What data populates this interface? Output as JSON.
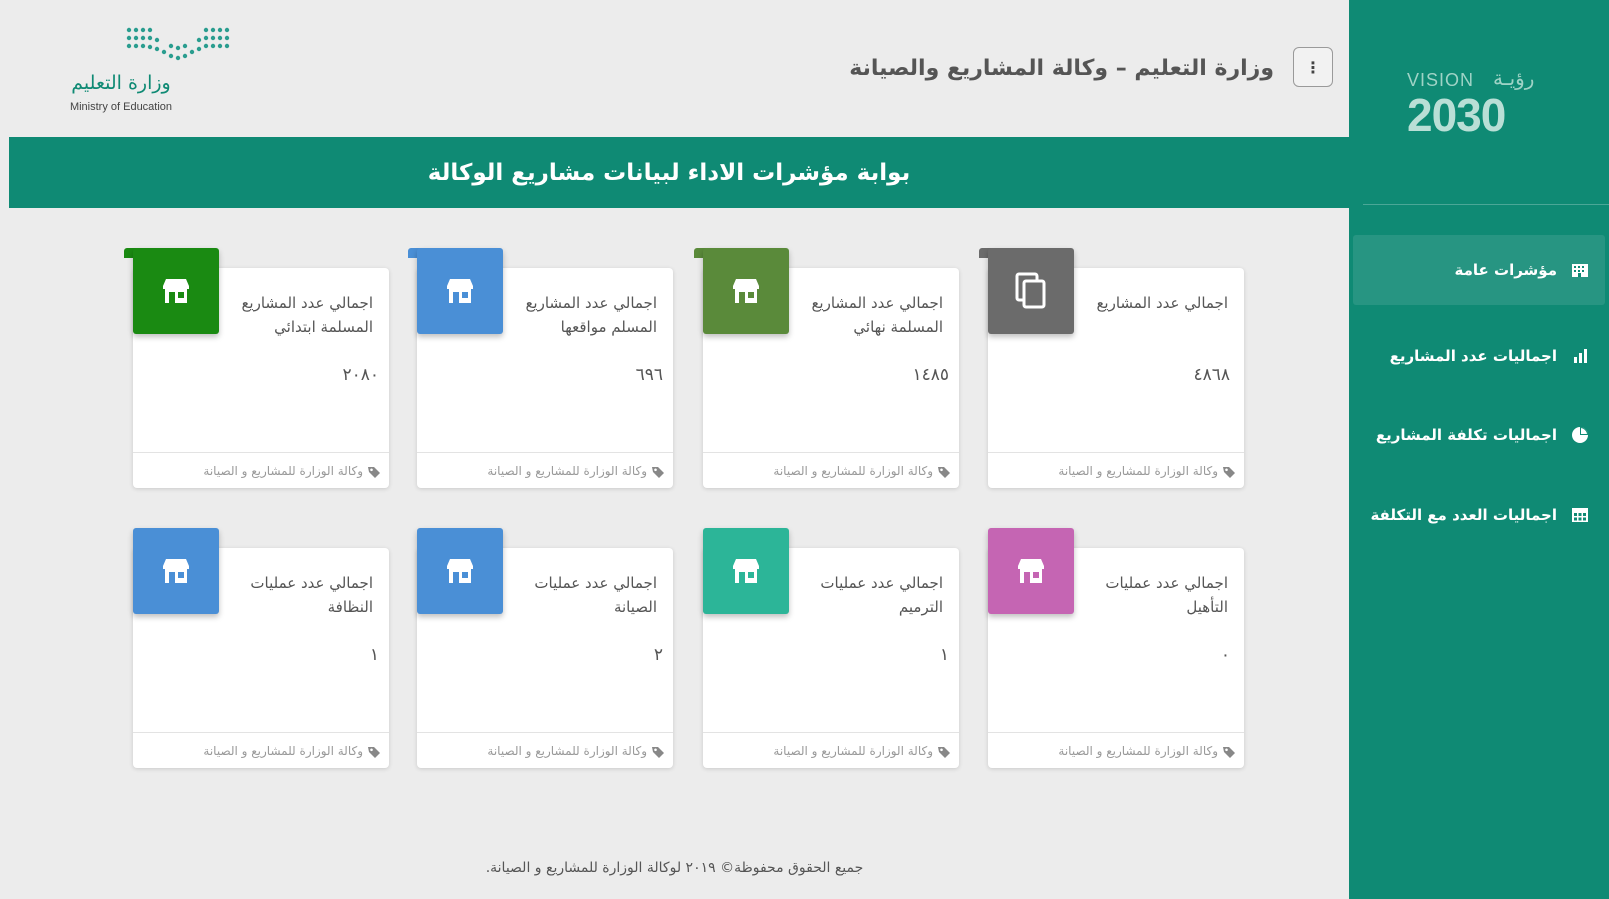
{
  "header": {
    "title": "وزارة التعليم – وكالة المشاريع والصيانة",
    "logo_arabic": "وزارة التعليم",
    "logo_english": "Ministry of Education",
    "menu_icon": "vertical-dots-icon",
    "menu_label": "⋮"
  },
  "banner": {
    "title": "بوابة مؤشرات الاداء لبيانات مشاريع الوكالة"
  },
  "sidebar": {
    "vision_word": "VISION",
    "vision_arabic": "رؤيـة",
    "vision_year": "2030",
    "items": [
      {
        "label": "مؤشرات عامة",
        "icon": "building-icon",
        "active": true
      },
      {
        "label": "اجماليات عدد المشاريع",
        "icon": "bar-chart-icon",
        "active": false
      },
      {
        "label": "اجماليات تكلفة المشاريع",
        "icon": "pie-chart-icon",
        "active": false
      },
      {
        "label": "اجماليات العدد مع التكلفة",
        "icon": "table-icon",
        "active": false
      }
    ]
  },
  "cards": [
    {
      "label": "اجمالي عدد المشاريع",
      "value": "٤٨٦٨",
      "color": "#6b6b6b",
      "icon": "copy-icon",
      "footer": "وكالة الوزارة للمشاريع و الصيانة"
    },
    {
      "label": "اجمالي عدد المشاريع المسلمة نهائي",
      "value": "١٤٨٥",
      "color": "#5a8a3a",
      "icon": "store-icon",
      "footer": "وكالة الوزارة للمشاريع و الصيانة"
    },
    {
      "label": "اجمالي عدد المشاريع المسلم مواقعها",
      "value": "٦٩٦",
      "color": "#4a8fd6",
      "icon": "store-icon",
      "footer": "وكالة الوزارة للمشاريع و الصيانة"
    },
    {
      "label": "اجمالي عدد المشاريع المسلمة ابتدائي",
      "value": "٢٠٨٠",
      "color": "#1a8a12",
      "icon": "store-icon",
      "footer": "وكالة الوزارة للمشاريع و الصيانة"
    },
    {
      "label": "اجمالي عدد عمليات التأهيل",
      "value": "٠",
      "color": "#c565b3",
      "icon": "store-icon",
      "footer": "وكالة الوزارة للمشاريع و الصيانة"
    },
    {
      "label": "اجمالي عدد عمليات الترميم",
      "value": "١",
      "color": "#2cb598",
      "icon": "store-icon",
      "footer": "وكالة الوزارة للمشاريع و الصيانة"
    },
    {
      "label": "اجمالي عدد عمليات الصيانة",
      "value": "٢",
      "color": "#4a8fd6",
      "icon": "store-icon",
      "footer": "وكالة الوزارة للمشاريع و الصيانة"
    },
    {
      "label": "اجمالي عدد عمليات النظافة",
      "value": "١",
      "color": "#4a8fd6",
      "icon": "store-icon",
      "footer": "وكالة الوزارة للمشاريع و الصيانة"
    }
  ],
  "copyright": "جميع الحقوق محفوظة© ٢٠١٩ لوكالة الوزارة للمشاريع و الصيانة."
}
